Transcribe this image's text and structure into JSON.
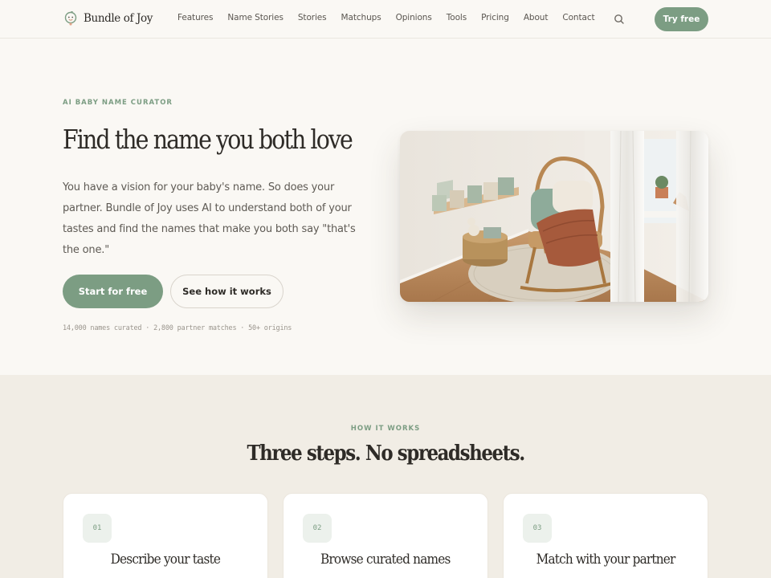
{
  "header": {
    "logo_text": "Bundle of Joy",
    "nav": [
      "Features",
      "Name Stories",
      "Stories",
      "Matchups",
      "Opinions",
      "Tools",
      "Pricing",
      "About",
      "Contact"
    ],
    "search_icon": "search-icon",
    "cta_label": "Try free"
  },
  "hero": {
    "eyebrow": "AI BABY NAME CURATOR",
    "title": "Find the name you both love",
    "body": "You have a vision for your baby's name. So does your partner. Bundle of Joy uses AI to understand both of your tastes and find the names that make you both say \"that's the one.\"",
    "primary_button": "Start for free",
    "secondary_button": "See how it works",
    "stats": "14,000 names curated · 2,800 partner matches · 50+ origins"
  },
  "how_it_works": {
    "eyebrow": "HOW IT WORKS",
    "title": "Three steps. No spreadsheets.",
    "steps": [
      {
        "number": "01",
        "title": "Describe your taste"
      },
      {
        "number": "02",
        "title": "Browse curated names"
      },
      {
        "number": "03",
        "title": "Match with your partner"
      }
    ]
  },
  "colors": {
    "accent": "#7c9d83",
    "page_bg": "#faf8f4",
    "section_bg": "#f1ede5",
    "text": "#2e2b27"
  }
}
